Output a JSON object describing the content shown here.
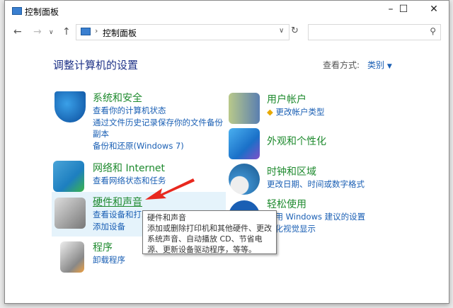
{
  "window": {
    "title": "控制面板"
  },
  "address": {
    "crumb": "控制面板",
    "search_placeholder": ""
  },
  "heading": "调整计算机的设置",
  "view_by": {
    "label": "查看方式:",
    "value": "类别"
  },
  "categories": {
    "system": {
      "title": "系统和安全",
      "links": [
        "查看你的计算机状态",
        "通过文件历史记录保存你的文件备份",
        "副本",
        "备份和还原(Windows 7)"
      ]
    },
    "network": {
      "title": "网络和 Internet",
      "links": [
        "查看网络状态和任务"
      ]
    },
    "hardware": {
      "title": "硬件和声音",
      "links": [
        "查看设备和打印机",
        "添加设备"
      ]
    },
    "programs": {
      "title": "程序",
      "links": [
        "卸载程序"
      ]
    },
    "users": {
      "title": "用户帐户",
      "links": [
        "更改帐户类型"
      ]
    },
    "appearance": {
      "title": "外观和个性化",
      "links": []
    },
    "clock": {
      "title": "时钟和区域",
      "links": [
        "更改日期、时间或数字格式"
      ]
    },
    "ease": {
      "title": "轻松使用",
      "links": [
        "使用 Windows 建议的设置",
        "优化视觉显示"
      ]
    }
  },
  "tooltip": {
    "title": "硬件和声音",
    "body": "添加或删除打印机和其他硬件、更改系统声音、自动播放 CD、节省电源、更新设备驱动程序，等等。"
  }
}
